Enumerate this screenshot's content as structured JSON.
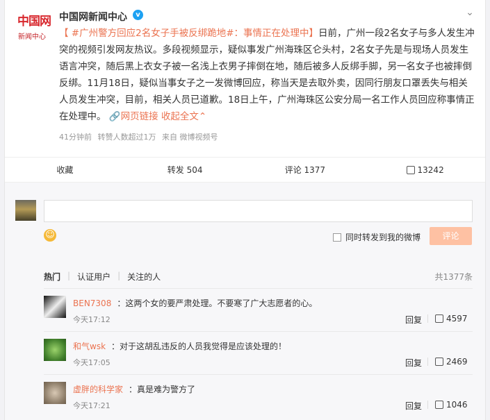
{
  "post": {
    "logo_line1": "中国网",
    "logo_line2": "新闻中心",
    "author": "中国网新闻中心",
    "verified_badge": "v",
    "more_icon": "chevron-down",
    "hashtag": "【 #广州警方回应2名女子手被反绑跪地#：事情正在处理中】",
    "text": "日前，广州一段2名女子与多人发生冲突的视频引发网友热议。多段视频显示，疑似事发广州海珠区仑头村，2名女子先是与现场人员发生语言冲突，随后黑上衣女子被一名浅上衣男子摔倒在地，随后被多人反绑手脚，另一名女子也被摔倒反绑。11月18日，疑似当事女子之一发微博回应，称当天是去取外卖，因同行朋友口罩丢失与相关人员发生冲突，目前，相关人员已道歉。18日上午，广州海珠区公安分局一名工作人员回应称事情正在处理中。",
    "web_link": "网页链接",
    "collapse": "收起全文",
    "meta_time": "41分钟前",
    "meta_reposts": "转赞人数超过1万",
    "meta_source": "来自 微博视频号"
  },
  "actions": {
    "favorite": "收藏",
    "repost": "转发 504",
    "comment": "评论 1377",
    "like": "13242"
  },
  "comment_box": {
    "forward_label": "同时转发到我的微博",
    "submit": "评论"
  },
  "tabs": {
    "hot": "热门",
    "verified": "认证用户",
    "following": "关注的人",
    "total": "共1377条"
  },
  "comments": [
    {
      "user": "BEN7308",
      "colon": "：",
      "text": "这两个女的要严肃处理。不要寒了广大志愿者的心。",
      "time": "今天17:12",
      "reply": "回复",
      "likes": "4597"
    },
    {
      "user": "和气wsk",
      "colon": "：",
      "text": "对于这胡乱违反的人员我觉得是应该处理的！",
      "time": "今天17:05",
      "reply": "回复",
      "likes": "2469"
    },
    {
      "user": "虚胖的科学家",
      "colon": "：",
      "text": "真是难为警方了",
      "time": "今天17:21",
      "reply": "回复",
      "likes": "1046"
    }
  ],
  "colors": {
    "accent": "#eb7350",
    "verified": "#1da1f2",
    "submit_bg": "#fec1a3"
  }
}
